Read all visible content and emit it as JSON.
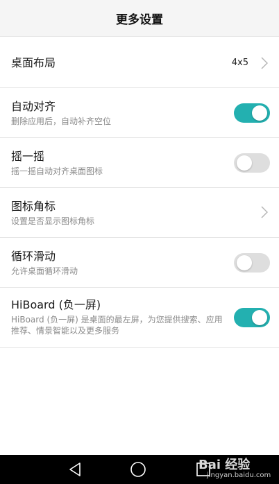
{
  "header": {
    "title": "更多设置"
  },
  "rows": [
    {
      "title": "桌面布局",
      "value": "4x5"
    },
    {
      "title": "自动对齐",
      "subtitle": "删除应用后，自动补齐空位",
      "toggle": "on"
    },
    {
      "title": "摇一摇",
      "subtitle": "摇一摇自动对齐桌面图标",
      "toggle": "off"
    },
    {
      "title": "图标角标",
      "subtitle": "设置是否显示图标角标"
    },
    {
      "title": "循环滑动",
      "subtitle": "允许桌面循环滑动",
      "toggle": "off"
    },
    {
      "title": "HiBoard (负一屏)",
      "subtitle": "HiBoard (负一屏) 是桌面的最左屏，为您提供搜索、应用推荐、情景智能以及更多服务",
      "toggle": "on"
    }
  ],
  "watermark": {
    "logo": "Bai 经验",
    "url": "jingyan.baidu.com"
  },
  "colors": {
    "accent": "#23b0b0",
    "toggle_off": "#dedede",
    "navbar": "#000000"
  }
}
